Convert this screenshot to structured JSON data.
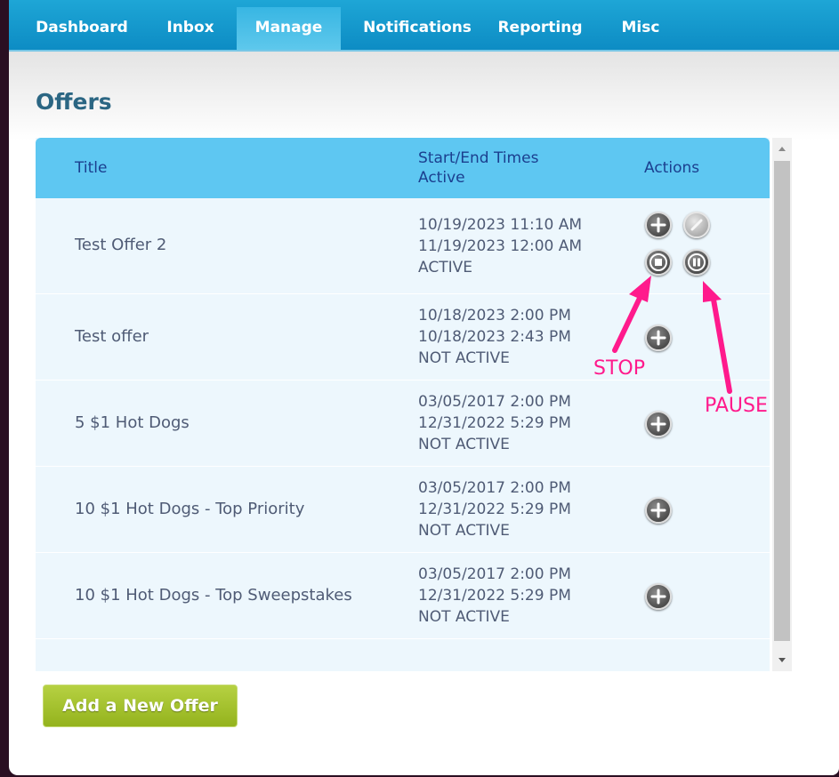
{
  "nav": {
    "items": [
      {
        "label": "Dashboard"
      },
      {
        "label": "Inbox"
      },
      {
        "label": "Manage"
      },
      {
        "label": "Notifications"
      },
      {
        "label": "Reporting"
      },
      {
        "label": "Misc"
      }
    ],
    "active": "Manage"
  },
  "page": {
    "title": "Offers"
  },
  "table": {
    "headers": {
      "title": "Title",
      "times_line1": "Start/End Times",
      "times_line2": "Active",
      "actions": "Actions"
    },
    "rows": [
      {
        "title": "Test Offer 2",
        "start": "10/19/2023 11:10 AM",
        "end": "11/19/2023 12:00 AM",
        "status": "ACTIVE",
        "actions": [
          "add-icon",
          "edit-icon-disabled",
          "stop-icon",
          "pause-icon"
        ]
      },
      {
        "title": "Test offer",
        "start": "10/18/2023 2:00 PM",
        "end": "10/18/2023 2:43 PM",
        "status": "NOT ACTIVE",
        "actions": [
          "add-icon"
        ]
      },
      {
        "title": "5 $1 Hot Dogs",
        "start": "03/05/2017 2:00 PM",
        "end": "12/31/2022 5:29 PM",
        "status": "NOT ACTIVE",
        "actions": [
          "add-icon"
        ]
      },
      {
        "title": "10 $1 Hot Dogs - Top Priority",
        "start": "03/05/2017 2:00 PM",
        "end": "12/31/2022 5:29 PM",
        "status": "NOT ACTIVE",
        "actions": [
          "add-icon"
        ]
      },
      {
        "title": "10 $1 Hot Dogs - Top Sweepstakes",
        "start": "03/05/2017 2:00 PM",
        "end": "12/31/2022 5:29 PM",
        "status": "NOT ACTIVE",
        "actions": [
          "add-icon"
        ]
      }
    ]
  },
  "add_button": {
    "label": "Add a New Offer"
  },
  "annotations": {
    "stop": "STOP",
    "pause": "PAUSE"
  },
  "colors": {
    "nav": "#1ea6d6",
    "header": "#5ec7f2",
    "row_bg": "#edf7fd",
    "button": "#a5c22f",
    "annotation": "#ff1a8c"
  }
}
